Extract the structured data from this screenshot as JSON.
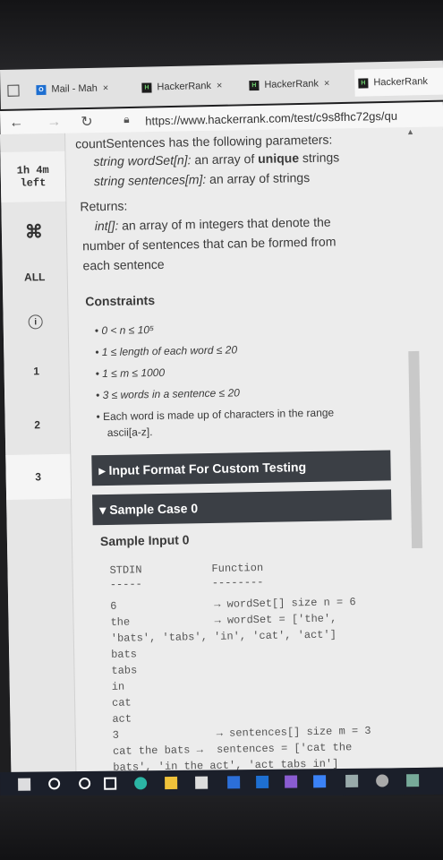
{
  "tabs": [
    {
      "label": "Mail - Mah",
      "close": "×"
    },
    {
      "label": "HackerRank",
      "close": "×"
    },
    {
      "label": "HackerRank",
      "close": "×"
    },
    {
      "label": "HackerRank"
    }
  ],
  "address": {
    "url": "https://www.hackerrank.com/test/c9s8fhc72gs/qu"
  },
  "sidebar": {
    "timer_line1": "1h 4m",
    "timer_line2": "left",
    "all_label": "ALL",
    "questions": [
      "1",
      "2",
      "3"
    ]
  },
  "content": {
    "params_heading": "countSentences has the following parameters:",
    "param1_prefix": "string wordSet[n]:",
    "param1_text_a": "an array of ",
    "param1_bold": "unique",
    "param1_text_b": " strings",
    "param2_prefix": "string sentences[m]:",
    "param2_text": "an array of strings",
    "returns_label": "Returns:",
    "returns_type": "int[]:",
    "returns_text_a": "an array of m integers that denote the",
    "returns_text_b": "number of sentences that can be formed from",
    "returns_text_c": "each sentence",
    "constraints_heading": "Constraints",
    "constraints": [
      "0 < n ≤ 10⁵",
      "1 ≤ length of each word ≤ 20",
      "1 ≤ m ≤ 1000",
      "3 ≤ words in a sentence ≤ 20",
      "Each word is made up of characters in the range",
      "ascii[a-z]."
    ],
    "input_format_bar": "Input Format For Custom Testing",
    "sample_case_bar": "Sample Case 0",
    "sample_input_label": "Sample Input 0",
    "stdin_header": "STDIN",
    "function_header": "Function",
    "stdin_dashes": "-----",
    "function_dashes": "--------",
    "lines": [
      {
        "left": "6",
        "right": "→ wordSet[] size n = 6"
      },
      {
        "left": "the",
        "right": "→ wordSet = ['the',"
      },
      {
        "left": "'bats', 'tabs', 'in', 'cat', 'act']",
        "right": ""
      },
      {
        "left": "bats",
        "right": ""
      },
      {
        "left": "tabs",
        "right": ""
      },
      {
        "left": "in",
        "right": ""
      },
      {
        "left": "cat",
        "right": ""
      },
      {
        "left": "act",
        "right": ""
      },
      {
        "left": "3",
        "right": "→ sentences[] size m = 3"
      },
      {
        "left": "cat the bats →",
        "right": "sentences = ['cat the"
      },
      {
        "left": "bats', 'in the act', 'act tabs in']",
        "right": ""
      }
    ]
  },
  "colors": {
    "bar_bg": "#3b3f45",
    "page_bg": "#ececec",
    "sidebar_bg": "#e6e6e6"
  }
}
